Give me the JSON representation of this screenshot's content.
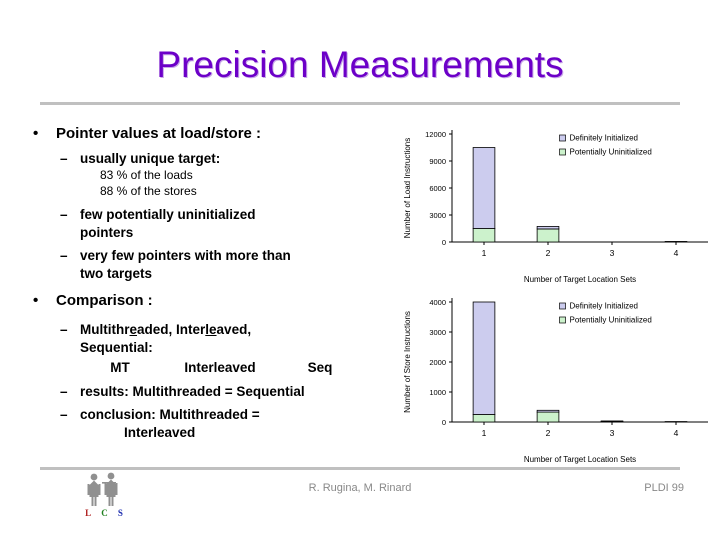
{
  "slide": {
    "title": "Precision Measurements"
  },
  "content": {
    "bullet1": {
      "marker": "•",
      "text": "Pointer values at load/store :"
    },
    "sub1": {
      "marker": "–",
      "text": "usually unique target:"
    },
    "detail1": "83 % of the loads",
    "detail2": "88 % of the stores",
    "sub2": {
      "marker": "–",
      "line1": "few potentially uninitialized",
      "line2": "pointers"
    },
    "sub3": {
      "marker": "–",
      "line1": "very few pointers with more than",
      "line2": "two targets"
    },
    "bullet2": {
      "marker": "•",
      "text": "Comparison :"
    },
    "sub4": {
      "marker": "–",
      "line1_a": "Multithr",
      "line1_u1": "e",
      "line1_b": "aded, Inter",
      "line1_u2": "le",
      "line1_c": "aved,",
      "line2": "Sequential:"
    },
    "compare_row": {
      "col1": "MT",
      "col2": "Interleaved",
      "col3": "Seq"
    },
    "sub5": {
      "marker": "–",
      "text": "results: Multithreaded = Sequential"
    },
    "sub6": {
      "marker": "–",
      "line1": "conclusion: Multithreaded =",
      "line2": "Interleaved"
    }
  },
  "footer": {
    "authors": "R. Rugina, M. Rinard",
    "venue": "PLDI 99"
  },
  "logo": {
    "l": "L",
    "c": "C",
    "s": "S",
    "l_color": "#b02020",
    "c_color": "#208020",
    "s_color": "#2030b0"
  },
  "colors": {
    "title": "#6c00c8",
    "rule": "#c0c0c0",
    "definitely_initialized": "#ccccee",
    "potentially_uninitialized": "#ccf2cc",
    "axis": "#000000",
    "footer_text": "#888888"
  },
  "chart_data": [
    {
      "type": "bar",
      "id": "loads",
      "title": "",
      "xlabel": "Number of Target Location Sets",
      "ylabel": "Number of Load Instructions",
      "categories": [
        "1",
        "2",
        "3",
        "4"
      ],
      "yticks": [
        "0",
        "3000",
        "6000",
        "9000",
        "12000"
      ],
      "ylim": [
        0,
        12000
      ],
      "grid": false,
      "legend_position": "top-right",
      "series": [
        {
          "name": "Potentially Uninitialized",
          "color": "#ccf2cc",
          "values": [
            1500,
            1450,
            40,
            60
          ]
        },
        {
          "name": "Definitely Initialized",
          "color": "#ccccee",
          "values": [
            9000,
            280,
            20,
            30
          ]
        }
      ]
    },
    {
      "type": "bar",
      "id": "stores",
      "title": "",
      "xlabel": "Number of Target Location Sets",
      "ylabel": "Number of Store Instructions",
      "categories": [
        "1",
        "2",
        "3",
        "4"
      ],
      "yticks": [
        "0",
        "1000",
        "2000",
        "3000",
        "4000"
      ],
      "ylim": [
        0,
        4000
      ],
      "grid": false,
      "legend_position": "top-right",
      "series": [
        {
          "name": "Potentially Uninitialized",
          "color": "#ccf2cc",
          "values": [
            250,
            330,
            20,
            15
          ]
        },
        {
          "name": "Definitely Initialized",
          "color": "#ccccee",
          "values": [
            3750,
            60,
            15,
            10
          ]
        }
      ]
    }
  ]
}
